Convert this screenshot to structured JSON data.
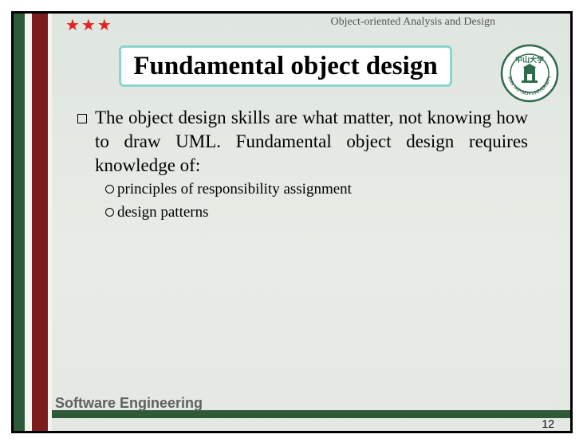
{
  "header": {
    "stars": "★★★",
    "course": "Object-oriented Analysis and Design"
  },
  "title": "Fundamental object design",
  "seal": {
    "icon": "university-seal-icon",
    "text": "SUN YAT-SEN UNIVERSITY",
    "chinese": "中山大学",
    "color": "#2f6b4c"
  },
  "content": {
    "bullet": "The object design skills are what matter, not knowing how to draw UML. Fundamental object design requires knowledge of:",
    "subitems": [
      "principles of responsibility assignment",
      "design patterns"
    ]
  },
  "footer": {
    "label": "Software Engineering",
    "page": "12"
  },
  "colors": {
    "green": "#2f5a3a",
    "red": "#7a1d1d",
    "title_border": "#8ad6cf",
    "stars": "#e32222"
  }
}
